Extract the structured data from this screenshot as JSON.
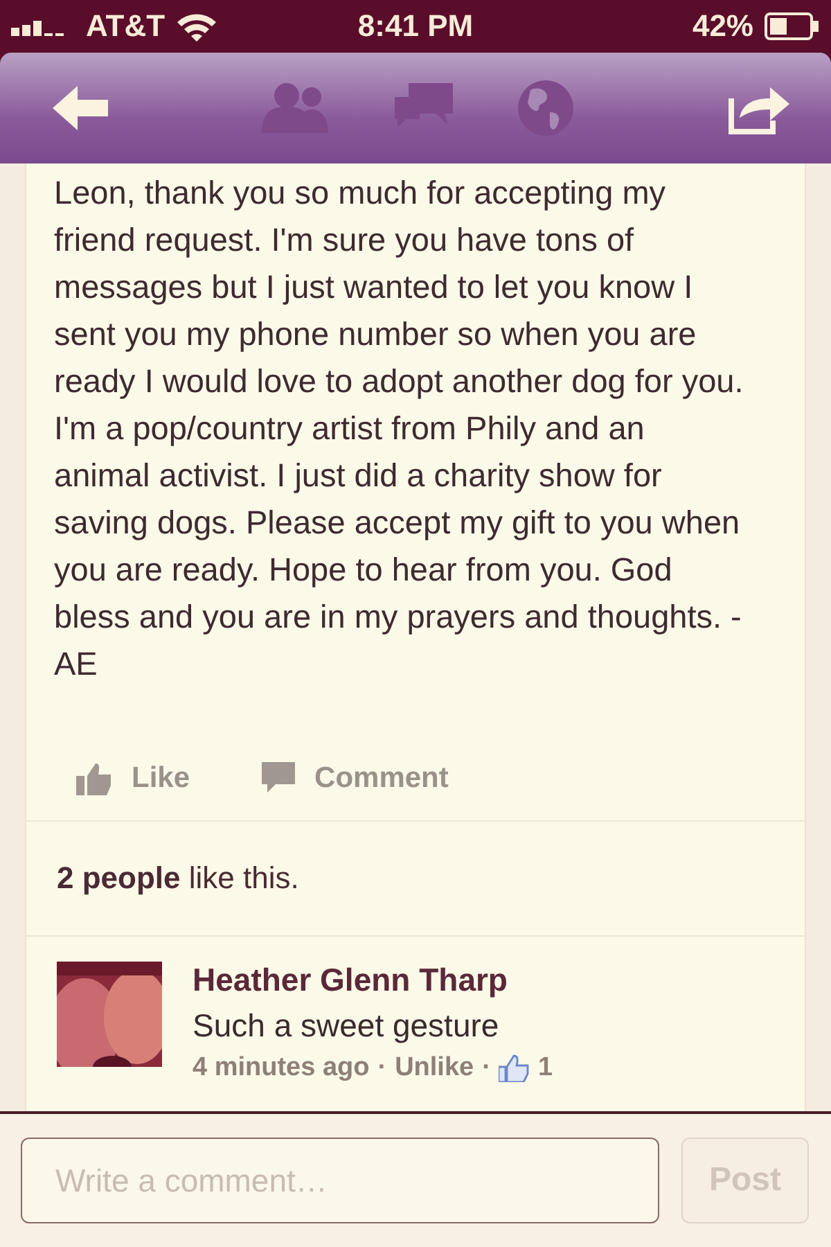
{
  "status_bar": {
    "carrier": "AT&T",
    "time": "8:41 PM",
    "battery": "42%"
  },
  "post": {
    "text": "Leon, thank you so much for accepting my friend request. I'm sure you have tons of messages but I just wanted to let you know I sent you my phone number so when you are ready I would love to adopt another dog for you. I'm a pop/country artist from Phily and an animal activist. I just did a charity show for saving dogs. Please accept my gift to you when you are ready. Hope to hear from you. God bless and you are in my prayers and thoughts. -AE"
  },
  "actions": [
    {
      "kind": "like",
      "label": "Like"
    },
    {
      "kind": "comment",
      "label": "Comment"
    }
  ],
  "likes_summary": "**2 people** like this.",
  "comments": [
    {
      "author": "Heather Glenn Tharp",
      "text": "Such a sweet gesture",
      "time": "4 minutes ago",
      "separator": "·",
      "action": "Unlike",
      "like_count": "1"
    }
  ],
  "composer": {
    "placeholder": "Write a comment…",
    "button": "Post"
  }
}
